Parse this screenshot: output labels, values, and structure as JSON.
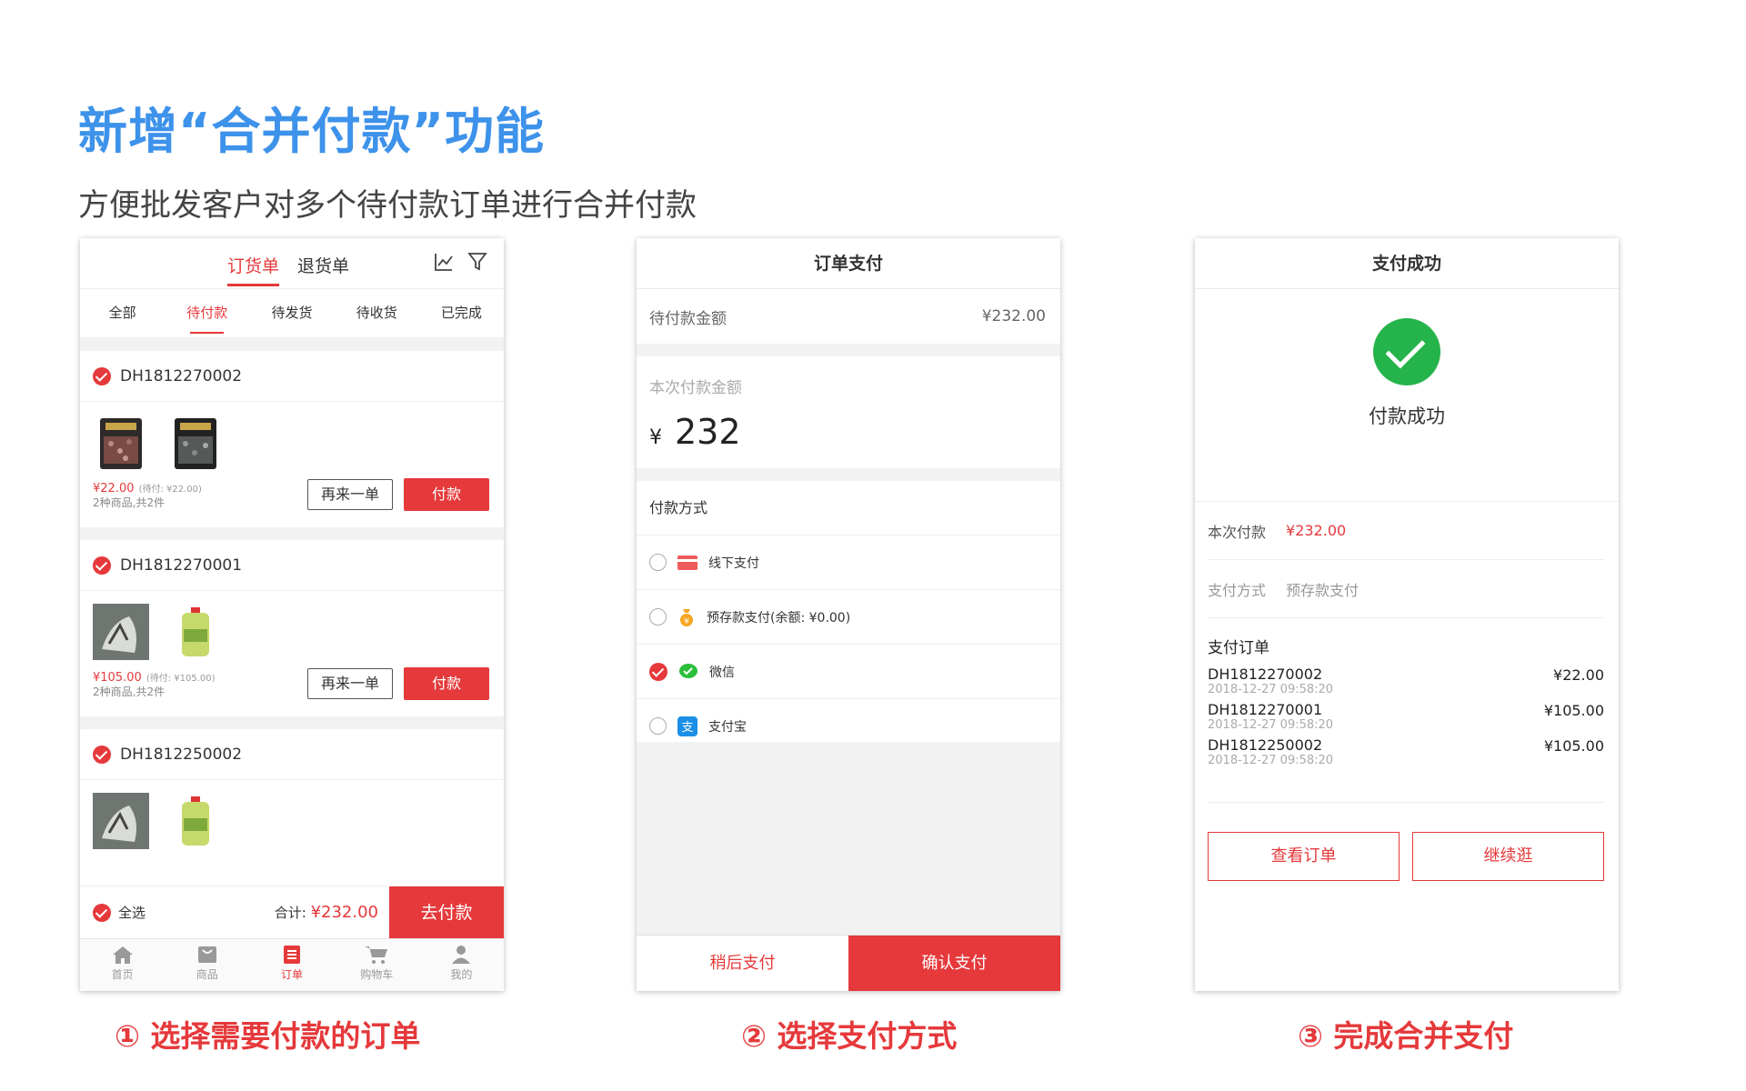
{
  "headline": "新增“合并付款”功能",
  "subline": "方便批发客户对多个待付款订单进行合并付款",
  "captions": [
    "① 选择需要付款的订单",
    "② 选择支付方式",
    "③ 完成合并支付"
  ],
  "colors": {
    "accent": "#e5393b",
    "headline": "#3d92ea",
    "success": "#25b34b"
  },
  "screen1": {
    "top_tabs": [
      "订货单",
      "退货单"
    ],
    "icons": [
      "chart-icon",
      "filter-icon"
    ],
    "sub_tabs": [
      "全部",
      "待付款",
      "待发货",
      "待收货",
      "已完成"
    ],
    "orders": [
      {
        "id": "DH1812270002",
        "price": "¥22.00",
        "due_note": "(待付: ¥22.00)",
        "count": "2种商品,共2件",
        "reorder": "再来一单",
        "pay": "付款"
      },
      {
        "id": "DH1812270001",
        "price": "¥105.00",
        "due_note": "(待付: ¥105.00)",
        "count": "2种商品,共2件",
        "reorder": "再来一单",
        "pay": "付款"
      },
      {
        "id": "DH1812250002"
      }
    ],
    "select_all": "全选",
    "total_label": "合计:",
    "total_value": "¥232.00",
    "go_pay": "去付款",
    "tabbar": [
      "首页",
      "商品",
      "订单",
      "购物车",
      "我的"
    ]
  },
  "screen2": {
    "title": "订单支付",
    "due_label": "待付款金额",
    "due_value": "¥232.00",
    "amount_label": "本次付款金额",
    "amount_currency": "¥",
    "amount_value": "232",
    "method_title": "付款方式",
    "methods": [
      "线下支付",
      "预存款支付(余额: ¥0.00)",
      "微信",
      "支付宝"
    ],
    "later": "稍后支付",
    "confirm": "确认支付"
  },
  "screen3": {
    "title": "支付成功",
    "success_text": "付款成功",
    "paid_label": "本次付款",
    "paid_value": "¥232.00",
    "method_label": "支付方式",
    "method_value": "预存款支付",
    "orders_title": "支付订单",
    "orders": [
      {
        "id": "DH1812270002",
        "time": "2018-12-27 09:58:20",
        "amount": "¥22.00"
      },
      {
        "id": "DH1812270001",
        "time": "2018-12-27 09:58:20",
        "amount": "¥105.00"
      },
      {
        "id": "DH1812250002",
        "time": "2018-12-27 09:58:20",
        "amount": "¥105.00"
      }
    ],
    "view_order": "查看订单",
    "continue": "继续逛"
  }
}
